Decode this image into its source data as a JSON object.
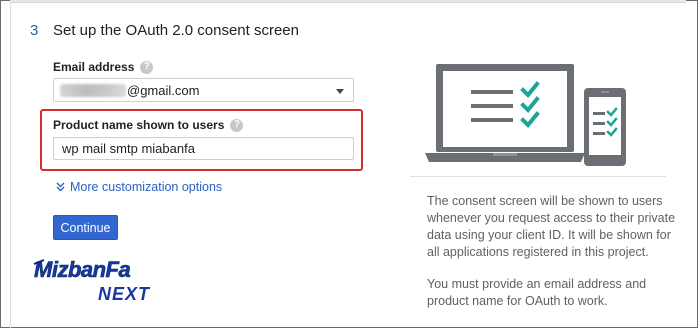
{
  "step": {
    "number": "3",
    "title": "Set up the OAuth 2.0 consent screen"
  },
  "email": {
    "label": "Email address",
    "value_visible": "@gmail.com"
  },
  "product": {
    "label": "Product name shown to users",
    "value": "wp mail smtp miabanfa"
  },
  "help_icon_text": "?",
  "more_options_label": "More customization options",
  "continue_label": "Continue",
  "logo": {
    "line1": "MizbanFa",
    "line2": "NEXT"
  },
  "description": {
    "p1": "The consent screen will be shown to users whenever you request access to their private data using your client ID. It will be shown for all applications registered in this project.",
    "p2": "You must provide an email address and product name for OAuth to work."
  },
  "colors": {
    "accent": "#2a62c4",
    "button": "#3266d0",
    "highlight": "#d32f2f",
    "check": "#1ca594",
    "illustration_gray": "#6b6f73"
  }
}
